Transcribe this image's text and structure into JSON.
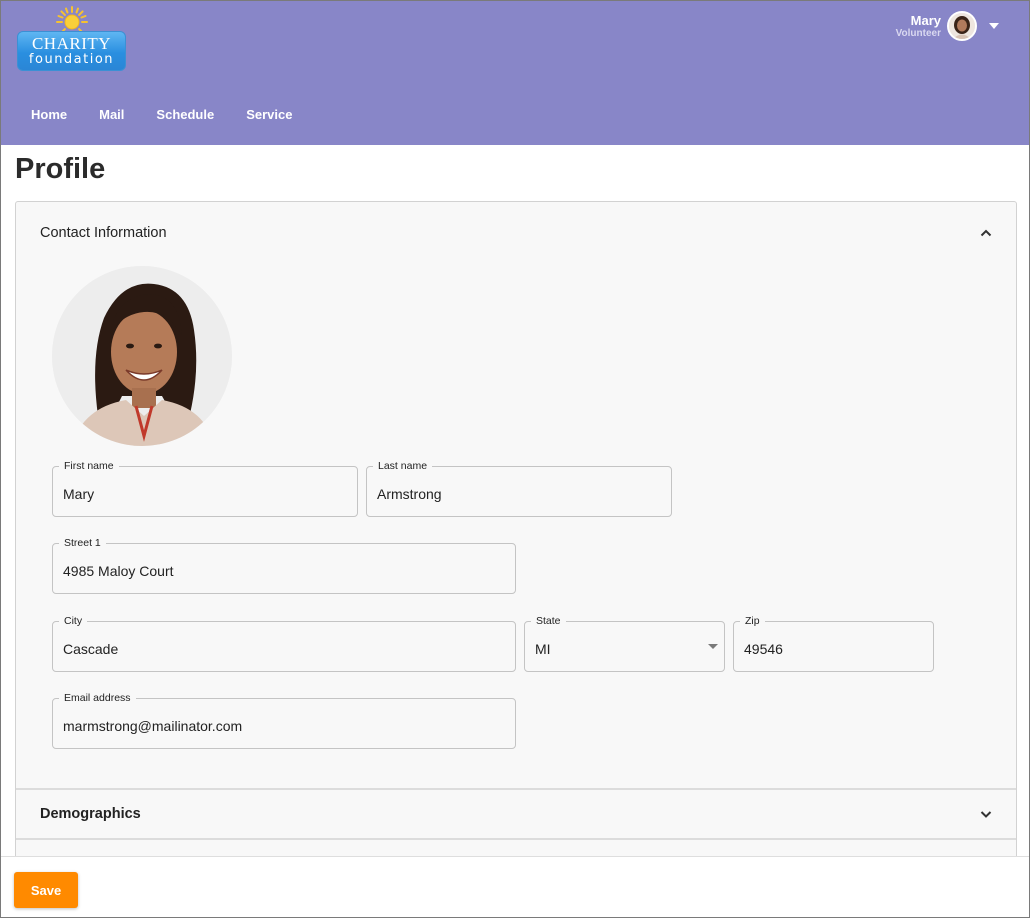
{
  "brand": {
    "logo_line1": "CHARITY",
    "logo_line2": "foundation",
    "header_color": "#8886c8"
  },
  "user": {
    "name": "Mary",
    "role": "Volunteer"
  },
  "nav": {
    "items": [
      {
        "label": "Home"
      },
      {
        "label": "Mail"
      },
      {
        "label": "Schedule"
      },
      {
        "label": "Service"
      }
    ]
  },
  "page": {
    "title": "Profile"
  },
  "sections": {
    "contact": {
      "title": "Contact Information",
      "expanded": true
    },
    "demographics": {
      "title": "Demographics",
      "expanded": false
    }
  },
  "form": {
    "first_name": {
      "label": "First name",
      "value": "Mary"
    },
    "last_name": {
      "label": "Last name",
      "value": "Armstrong"
    },
    "street1": {
      "label": "Street 1",
      "value": "4985 Maloy Court"
    },
    "city": {
      "label": "City",
      "value": "Cascade"
    },
    "state": {
      "label": "State",
      "value": "MI"
    },
    "zip": {
      "label": "Zip",
      "value": "49546"
    },
    "email": {
      "label": "Email address",
      "value": "marmstrong@mailinator.com"
    }
  },
  "footer": {
    "save_label": "Save",
    "save_color": "#ff8a00"
  },
  "icons": [
    "sun-icon",
    "chevron-up-icon",
    "chevron-down-icon",
    "caret-down-icon"
  ]
}
